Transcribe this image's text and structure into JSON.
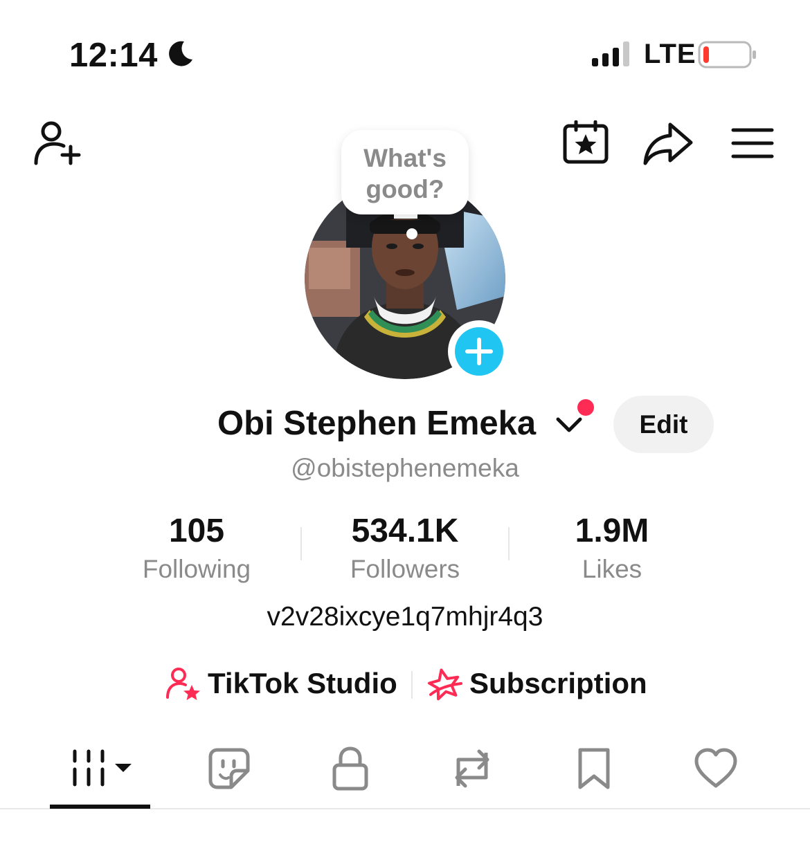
{
  "status_bar": {
    "time": "12:14",
    "network": "LTE",
    "battery_level": 0.12,
    "battery_color": "#ff3b30"
  },
  "top_nav": {
    "left_icon": "add-friend-icon",
    "right_icons": [
      "calendar-star-icon",
      "share-arrow-icon",
      "hamburger-menu-icon"
    ]
  },
  "profile": {
    "note_bubble": "What's good?",
    "avatar_icon": "profile-photo",
    "add_badge_color": "#20c5f2",
    "name": "Obi Stephen Emeka",
    "notification_dot_color": "#fe2c55",
    "edit_label": "Edit",
    "handle": "@obistephenemeka",
    "bio": "v2v28ixcye1q7mhjr4q3"
  },
  "stats": [
    {
      "value": "105",
      "label": "Following"
    },
    {
      "value": "534.1K",
      "label": "Followers"
    },
    {
      "value": "1.9M",
      "label": "Likes"
    }
  ],
  "links": {
    "studio_label": "TikTok Studio",
    "subscription_label": "Subscription",
    "accent_color": "#fe2c55"
  },
  "tabs": [
    {
      "icon": "grid-videos-icon",
      "active": true
    },
    {
      "icon": "sticker-icon",
      "active": false
    },
    {
      "icon": "lock-icon",
      "active": false
    },
    {
      "icon": "repost-icon",
      "active": false
    },
    {
      "icon": "bookmark-icon",
      "active": false
    },
    {
      "icon": "heart-icon",
      "active": false
    }
  ]
}
